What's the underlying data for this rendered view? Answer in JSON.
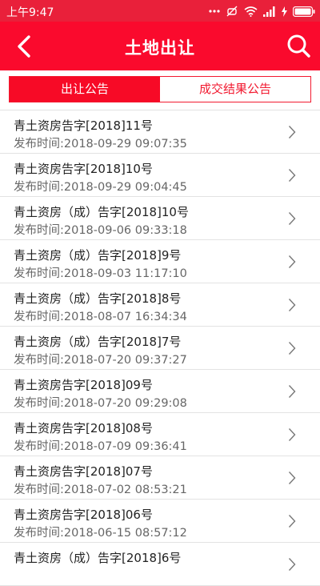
{
  "status": {
    "time": "上午9:47"
  },
  "header": {
    "title": "土地出让"
  },
  "tabs": [
    {
      "label": "出让公告",
      "active": true
    },
    {
      "label": "成交结果公告",
      "active": false
    }
  ],
  "items": [
    {
      "title": "青土资房告字[2018]11号",
      "date": "发布时间:2018-09-29 09:07:35"
    },
    {
      "title": "青土资房告字[2018]10号",
      "date": "发布时间:2018-09-29 09:04:45"
    },
    {
      "title": "青土资房（成）告字[2018]10号",
      "date": "发布时间:2018-09-06 09:33:18"
    },
    {
      "title": "青土资房（成）告字[2018]9号",
      "date": "发布时间:2018-09-03 11:17:10"
    },
    {
      "title": "青土资房（成）告字[2018]8号",
      "date": "发布时间:2018-08-07 16:34:34"
    },
    {
      "title": "青土资房（成）告字[2018]7号",
      "date": "发布时间:2018-07-20 09:37:27"
    },
    {
      "title": "青土资房告字[2018]09号",
      "date": "发布时间:2018-07-20 09:29:08"
    },
    {
      "title": "青土资房告字[2018]08号",
      "date": "发布时间:2018-07-09 09:36:41"
    },
    {
      "title": "青土资房告字[2018]07号",
      "date": "发布时间:2018-07-02 08:53:21"
    },
    {
      "title": "青土资房告字[2018]06号",
      "date": "发布时间:2018-06-15 08:57:12"
    },
    {
      "title": "青土资房（成）告字[2018]6号",
      "date": ""
    }
  ],
  "colors": {
    "accent": "#fa0a2d"
  },
  "icons": {
    "back": "chevron-left-icon",
    "search": "search-icon",
    "row": "chevron-right-icon"
  }
}
